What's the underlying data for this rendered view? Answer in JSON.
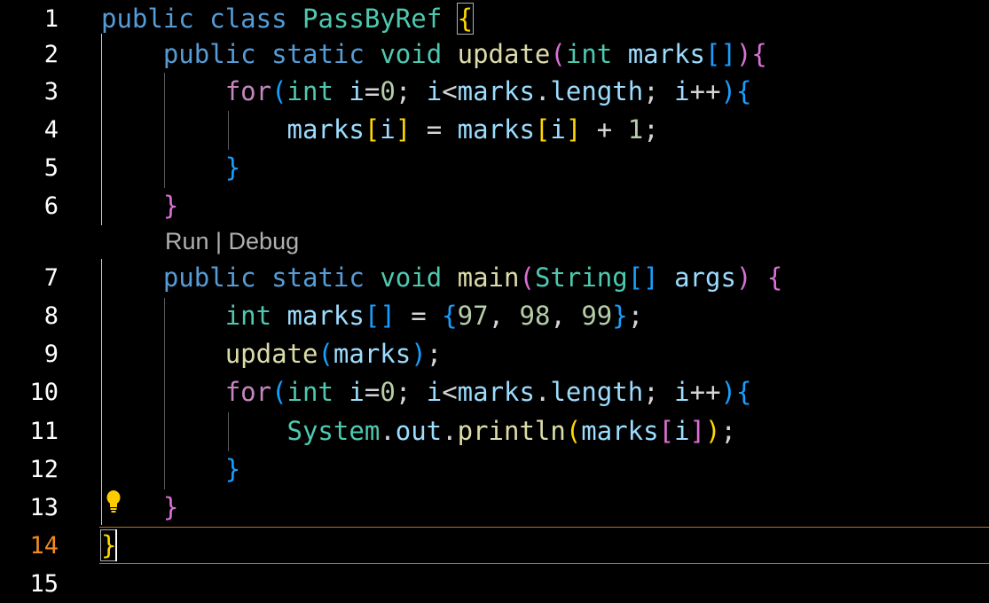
{
  "editor": {
    "line_numbers": [
      "1",
      "2",
      "3",
      "4",
      "5",
      "6",
      "7",
      "8",
      "9",
      "10",
      "11",
      "12",
      "13",
      "14",
      "15"
    ],
    "codelens": "Run | Debug",
    "lines": [
      [
        {
          "t": "public",
          "c": "kw"
        },
        {
          "t": " ",
          "c": "op"
        },
        {
          "t": "class",
          "c": "kw"
        },
        {
          "t": " ",
          "c": "op"
        },
        {
          "t": "PassByRef",
          "c": "ty"
        },
        {
          "t": " ",
          "c": "op"
        },
        {
          "t": "{",
          "c": "b1 hl-br"
        }
      ],
      [
        {
          "t": "    ",
          "c": "op"
        },
        {
          "t": "public",
          "c": "kw"
        },
        {
          "t": " ",
          "c": "op"
        },
        {
          "t": "static",
          "c": "kw"
        },
        {
          "t": " ",
          "c": "op"
        },
        {
          "t": "void",
          "c": "ty"
        },
        {
          "t": " ",
          "c": "op"
        },
        {
          "t": "update",
          "c": "fn"
        },
        {
          "t": "(",
          "c": "b2"
        },
        {
          "t": "int",
          "c": "ty"
        },
        {
          "t": " ",
          "c": "op"
        },
        {
          "t": "marks",
          "c": "var"
        },
        {
          "t": "[]",
          "c": "b3"
        },
        {
          "t": ")",
          "c": "b2"
        },
        {
          "t": "{",
          "c": "b2"
        }
      ],
      [
        {
          "t": "        ",
          "c": "op"
        },
        {
          "t": "for",
          "c": "ctl"
        },
        {
          "t": "(",
          "c": "b3"
        },
        {
          "t": "int",
          "c": "ty"
        },
        {
          "t": " ",
          "c": "op"
        },
        {
          "t": "i",
          "c": "var"
        },
        {
          "t": "=",
          "c": "op"
        },
        {
          "t": "0",
          "c": "num"
        },
        {
          "t": "; ",
          "c": "op"
        },
        {
          "t": "i",
          "c": "var"
        },
        {
          "t": "<",
          "c": "op"
        },
        {
          "t": "marks",
          "c": "var"
        },
        {
          "t": ".",
          "c": "op"
        },
        {
          "t": "length",
          "c": "var"
        },
        {
          "t": "; ",
          "c": "op"
        },
        {
          "t": "i",
          "c": "var"
        },
        {
          "t": "++",
          "c": "op"
        },
        {
          "t": ")",
          "c": "b3"
        },
        {
          "t": "{",
          "c": "b3"
        }
      ],
      [
        {
          "t": "            ",
          "c": "op"
        },
        {
          "t": "marks",
          "c": "var"
        },
        {
          "t": "[",
          "c": "b1"
        },
        {
          "t": "i",
          "c": "var"
        },
        {
          "t": "]",
          "c": "b1"
        },
        {
          "t": " = ",
          "c": "op"
        },
        {
          "t": "marks",
          "c": "var"
        },
        {
          "t": "[",
          "c": "b1"
        },
        {
          "t": "i",
          "c": "var"
        },
        {
          "t": "]",
          "c": "b1"
        },
        {
          "t": " + ",
          "c": "op"
        },
        {
          "t": "1",
          "c": "num"
        },
        {
          "t": ";",
          "c": "op"
        }
      ],
      [
        {
          "t": "        ",
          "c": "op"
        },
        {
          "t": "}",
          "c": "b3"
        }
      ],
      [
        {
          "t": "    ",
          "c": "op"
        },
        {
          "t": "}",
          "c": "b2"
        }
      ],
      [
        {
          "t": "    ",
          "c": "op"
        },
        {
          "t": "public",
          "c": "kw"
        },
        {
          "t": " ",
          "c": "op"
        },
        {
          "t": "static",
          "c": "kw"
        },
        {
          "t": " ",
          "c": "op"
        },
        {
          "t": "void",
          "c": "ty"
        },
        {
          "t": " ",
          "c": "op"
        },
        {
          "t": "main",
          "c": "fn"
        },
        {
          "t": "(",
          "c": "b2"
        },
        {
          "t": "String",
          "c": "ty"
        },
        {
          "t": "[]",
          "c": "b3"
        },
        {
          "t": " ",
          "c": "op"
        },
        {
          "t": "args",
          "c": "var"
        },
        {
          "t": ")",
          "c": "b2"
        },
        {
          "t": " ",
          "c": "op"
        },
        {
          "t": "{",
          "c": "b2"
        }
      ],
      [
        {
          "t": "        ",
          "c": "op"
        },
        {
          "t": "int",
          "c": "ty"
        },
        {
          "t": " ",
          "c": "op"
        },
        {
          "t": "marks",
          "c": "var"
        },
        {
          "t": "[]",
          "c": "b3"
        },
        {
          "t": " = ",
          "c": "op"
        },
        {
          "t": "{",
          "c": "b3"
        },
        {
          "t": "97",
          "c": "num"
        },
        {
          "t": ", ",
          "c": "op"
        },
        {
          "t": "98",
          "c": "num"
        },
        {
          "t": ", ",
          "c": "op"
        },
        {
          "t": "99",
          "c": "num"
        },
        {
          "t": "}",
          "c": "b3"
        },
        {
          "t": ";",
          "c": "op"
        }
      ],
      [
        {
          "t": "        ",
          "c": "op"
        },
        {
          "t": "update",
          "c": "fn"
        },
        {
          "t": "(",
          "c": "b3"
        },
        {
          "t": "marks",
          "c": "var"
        },
        {
          "t": ")",
          "c": "b3"
        },
        {
          "t": ";",
          "c": "op"
        }
      ],
      [
        {
          "t": "        ",
          "c": "op"
        },
        {
          "t": "for",
          "c": "ctl"
        },
        {
          "t": "(",
          "c": "b3"
        },
        {
          "t": "int",
          "c": "ty"
        },
        {
          "t": " ",
          "c": "op"
        },
        {
          "t": "i",
          "c": "var"
        },
        {
          "t": "=",
          "c": "op"
        },
        {
          "t": "0",
          "c": "num"
        },
        {
          "t": "; ",
          "c": "op"
        },
        {
          "t": "i",
          "c": "var"
        },
        {
          "t": "<",
          "c": "op"
        },
        {
          "t": "marks",
          "c": "var"
        },
        {
          "t": ".",
          "c": "op"
        },
        {
          "t": "length",
          "c": "var"
        },
        {
          "t": "; ",
          "c": "op"
        },
        {
          "t": "i",
          "c": "var"
        },
        {
          "t": "++",
          "c": "op"
        },
        {
          "t": ")",
          "c": "b3"
        },
        {
          "t": "{",
          "c": "b3"
        }
      ],
      [
        {
          "t": "            ",
          "c": "op"
        },
        {
          "t": "System",
          "c": "ty"
        },
        {
          "t": ".",
          "c": "op"
        },
        {
          "t": "out",
          "c": "var"
        },
        {
          "t": ".",
          "c": "op"
        },
        {
          "t": "println",
          "c": "fn"
        },
        {
          "t": "(",
          "c": "b1"
        },
        {
          "t": "marks",
          "c": "var"
        },
        {
          "t": "[",
          "c": "b2"
        },
        {
          "t": "i",
          "c": "var"
        },
        {
          "t": "]",
          "c": "b2"
        },
        {
          "t": ")",
          "c": "b1"
        },
        {
          "t": ";",
          "c": "op"
        }
      ],
      [
        {
          "t": "        ",
          "c": "op"
        },
        {
          "t": "}",
          "c": "b3"
        }
      ],
      [
        {
          "t": "    ",
          "c": "op"
        },
        {
          "t": "}",
          "c": "b2"
        }
      ],
      [
        {
          "t": "}",
          "c": "b1 hl-br"
        }
      ]
    ],
    "active_line": "14",
    "lightbulb_icon": "lightbulb-icon"
  },
  "colors": {
    "background": "#000000",
    "line_number": "#ffffff",
    "active_line_number": "#f08a24",
    "current_line_border": "#c26b22",
    "lightbulb": "#ffcc00"
  }
}
